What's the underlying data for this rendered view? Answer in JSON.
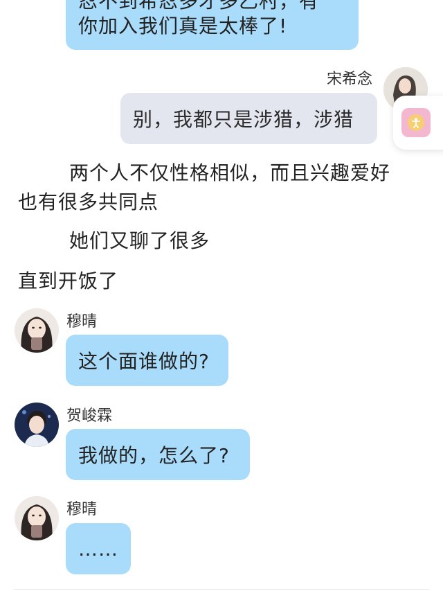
{
  "messages": [
    {
      "text_line1": "忍不到希忍多才多乙村，有",
      "text_line2": "你加入我们真是太棒了!"
    },
    {
      "sender": "宋希念",
      "text": "别，我都只是涉猎，涉猎"
    },
    {
      "sender": "穆晴",
      "text": "这个面谁做的?"
    },
    {
      "sender": "贺峻霖",
      "text": "我做的，怎么了?"
    },
    {
      "sender": "穆晴",
      "text": "……"
    }
  ],
  "narration": {
    "line1": "两个人不仅性格相似，而且兴趣爱好",
    "line2": "也有很多共同点",
    "line3": "她们又聊了很多",
    "line4": "直到开饭了"
  },
  "icons": {
    "floating_button": "accessibility-icon"
  },
  "colors": {
    "bubble_blue": "#a9dbfb",
    "bubble_grey": "#e3e6ee",
    "floating_pink": "#f3b8cf"
  }
}
